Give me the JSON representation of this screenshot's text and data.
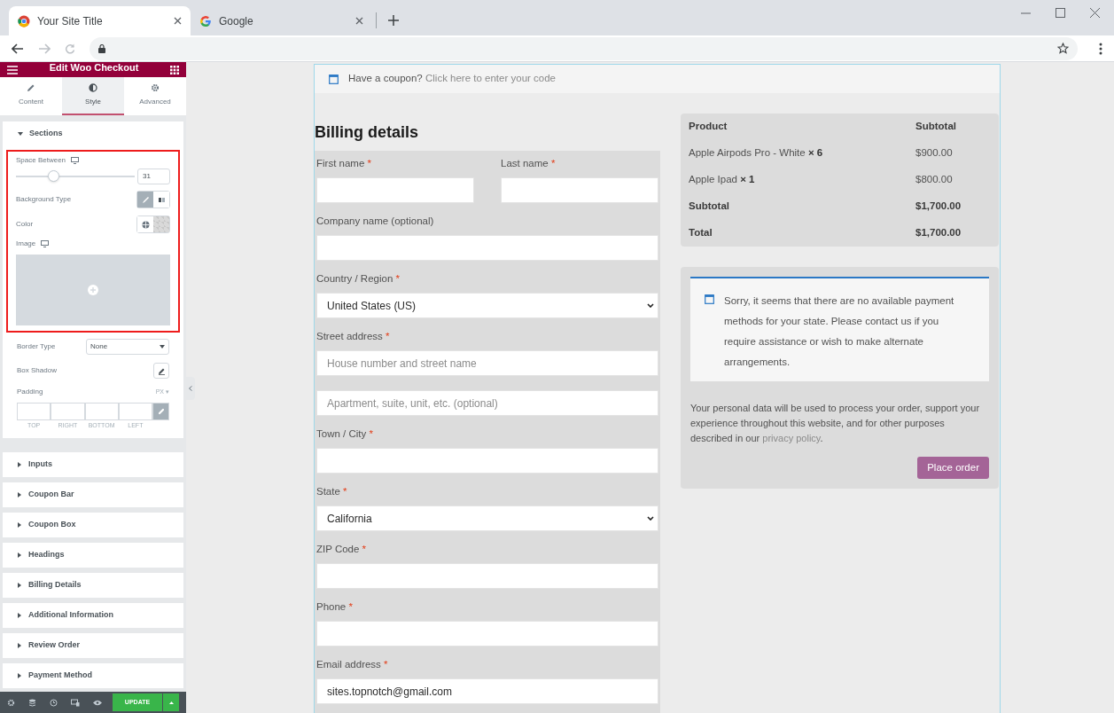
{
  "browser": {
    "tabs": [
      {
        "title": "Your Site Title",
        "selected": true
      },
      {
        "title": "Google",
        "selected": false
      }
    ]
  },
  "editor": {
    "title": "Edit Woo Checkout",
    "tabs": [
      {
        "label": "Content",
        "selected": false
      },
      {
        "label": "Style",
        "selected": true
      },
      {
        "label": "Advanced",
        "selected": false
      }
    ],
    "open_section": {
      "title": "Sections",
      "expanded": true
    },
    "space_between": {
      "label": "Space Between",
      "level": 0.31,
      "value": "31"
    },
    "background_type": {
      "label": "Background Type",
      "options": [
        {
          "selected": true
        },
        {
          "selected": false
        }
      ]
    },
    "color": {
      "label": "Color"
    },
    "image": {
      "label": "Image"
    },
    "border_type": {
      "label": "Border Type",
      "value": "None"
    },
    "box_shadow": {
      "label": "Box Shadow"
    },
    "padding": {
      "label": "Padding",
      "unit": "PX",
      "unit_caret": "▾",
      "sides": [
        "TOP",
        "RIGHT",
        "BOTTOM",
        "LEFT"
      ],
      "linked": true
    },
    "sections": [
      {
        "title": "Inputs",
        "expanded": false
      },
      {
        "title": "Coupon Bar",
        "expanded": false
      },
      {
        "title": "Coupon Box",
        "expanded": false
      },
      {
        "title": "Headings",
        "expanded": false
      },
      {
        "title": "Billing Details",
        "expanded": false
      },
      {
        "title": "Additional Information",
        "expanded": false
      },
      {
        "title": "Review Order",
        "expanded": false
      },
      {
        "title": "Payment Method",
        "expanded": false
      }
    ],
    "update_button": "UPDATE"
  },
  "page": {
    "coupon": {
      "text": "Have a coupon?",
      "link": "Click here to enter your code"
    },
    "billing": {
      "title": "Billing details",
      "fields": [
        {
          "kind": "text",
          "label": "First name",
          "required_mark": "*",
          "half": true
        },
        {
          "kind": "text",
          "label": "Last name",
          "required_mark": "*",
          "half": true
        },
        {
          "kind": "text",
          "label": "Company name (optional)",
          "half": false
        },
        {
          "kind": "select",
          "label": "Country / Region",
          "required_mark": "*",
          "half": false,
          "value": "United States (US)"
        },
        {
          "kind": "text",
          "label": "Street address",
          "required_mark": "*",
          "half": false,
          "placeholder": "House number and street name"
        },
        {
          "kind": "text",
          "half": false,
          "placeholder": "Apartment, suite, unit, etc. (optional)"
        },
        {
          "kind": "text",
          "label": "Town / City",
          "required_mark": "*",
          "half": false
        },
        {
          "kind": "select",
          "label": "State",
          "required_mark": "*",
          "half": false,
          "value": "California"
        },
        {
          "kind": "text",
          "label": "ZIP Code",
          "required_mark": "*",
          "half": false
        },
        {
          "kind": "text",
          "label": "Phone",
          "required_mark": "*",
          "half": false
        },
        {
          "kind": "text",
          "label": "Email address",
          "required_mark": "*",
          "half": false,
          "value": "sites.topnotch@gmail.com"
        }
      ]
    },
    "order": {
      "columns": [
        "Product",
        "Subtotal"
      ],
      "rows": [
        {
          "kind": "item",
          "product": "Apple Airpods Pro - White",
          "quantity": "× 6",
          "amount": "$900.00"
        },
        {
          "kind": "item",
          "product": "Apple Ipad",
          "quantity": "× 1",
          "amount": "$800.00"
        },
        {
          "kind": "total",
          "product": "Subtotal",
          "amount": "$1,700.00"
        },
        {
          "kind": "total",
          "product": "Total",
          "amount": "$1,700.00"
        }
      ]
    },
    "payment": {
      "notice": "Sorry, it seems that there are no available payment methods for your state. Please contact us if you require assistance or wish to make alternate arrangements.",
      "privacy": {
        "text": "Your personal data will be used to process your order, support your experience throughout this website, and for other purposes described in our",
        "link": "privacy policy",
        "end": "."
      },
      "button": "Place order"
    }
  }
}
